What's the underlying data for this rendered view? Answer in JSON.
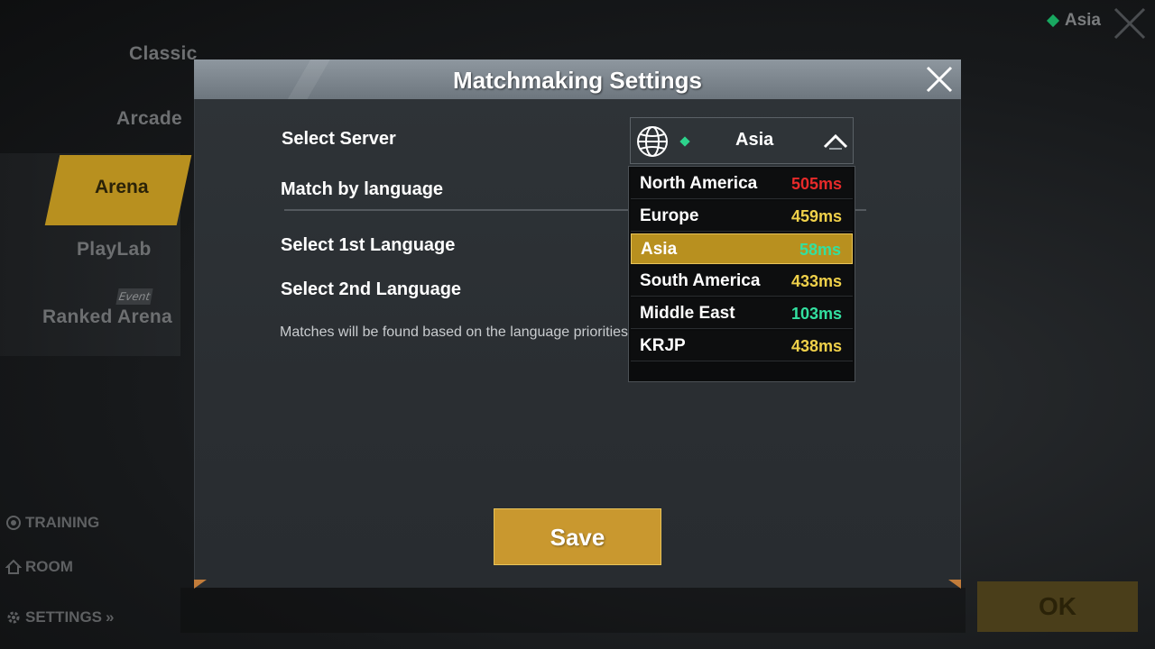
{
  "background": {
    "modes": [
      "Classic",
      "Arcade",
      "Arena",
      "PlayLab",
      "Ranked Arena"
    ],
    "active_mode": "Arena",
    "event_badge": "Event",
    "links": {
      "training": "TRAINING",
      "room": "ROOM",
      "settings": "SETTINGS"
    },
    "top_region": "Asia",
    "ok_label": "OK"
  },
  "modal": {
    "title": "Matchmaking Settings",
    "select_server_label": "Select Server",
    "match_language_label": "Match by language",
    "first_language_label": "Select 1st Language",
    "second_language_label": "Select 2nd Language",
    "hint": "Matches will be found based on the language priorities.",
    "save_label": "Save"
  },
  "server_select": {
    "value": "Asia",
    "icon": "globe-icon"
  },
  "servers": [
    {
      "name": "North America",
      "ping": "505ms",
      "color": "#e82a2a",
      "selected": false
    },
    {
      "name": "Europe",
      "ping": "459ms",
      "color": "#f0d14a",
      "selected": false
    },
    {
      "name": "Asia",
      "ping": "58ms",
      "color": "#33e0a0",
      "selected": true
    },
    {
      "name": "South America",
      "ping": "433ms",
      "color": "#f0d14a",
      "selected": false
    },
    {
      "name": "Middle East",
      "ping": "103ms",
      "color": "#33e0a0",
      "selected": false
    },
    {
      "name": "KRJP",
      "ping": "438ms",
      "color": "#f0d14a",
      "selected": false
    }
  ],
  "colors": {
    "accent_gold": "#c9982f",
    "ping_good": "#33e0a0",
    "ping_medium": "#f0d14a",
    "ping_bad": "#e82a2a"
  }
}
